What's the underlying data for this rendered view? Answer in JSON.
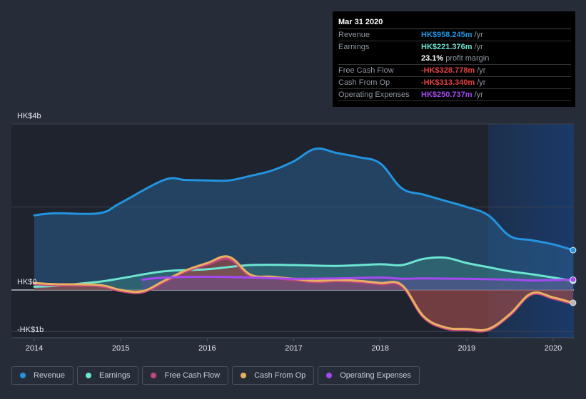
{
  "tooltip": {
    "date": "Mar 31 2020",
    "rows": [
      {
        "label": "Revenue",
        "value": "HK$958.245m",
        "unit": "/yr",
        "color": "#2394df"
      },
      {
        "label": "Earnings",
        "value": "HK$221.376m",
        "unit": "/yr",
        "color": "#6ce5d1"
      },
      {
        "label": "",
        "value": "23.1%",
        "unit": "profit margin",
        "color": "#ffffff"
      },
      {
        "label": "Free Cash Flow",
        "value": "-HK$328.778m",
        "unit": "/yr",
        "color": "#e64141"
      },
      {
        "label": "Cash From Op",
        "value": "-HK$313.340m",
        "unit": "/yr",
        "color": "#e64141"
      },
      {
        "label": "Operating Expenses",
        "value": "HK$250.737m",
        "unit": "/yr",
        "color": "#a44af1"
      }
    ]
  },
  "legend": [
    {
      "label": "Revenue",
      "color": "#2394df"
    },
    {
      "label": "Earnings",
      "color": "#6ce5d1"
    },
    {
      "label": "Free Cash Flow",
      "color": "#c4477f"
    },
    {
      "label": "Cash From Op",
      "color": "#e9b062"
    },
    {
      "label": "Operating Expenses",
      "color": "#a44af1"
    }
  ],
  "chart_data": {
    "type": "area",
    "title": "",
    "xlabel": "",
    "ylabel": "",
    "x_ticks": [
      "2014",
      "2015",
      "2016",
      "2017",
      "2018",
      "2019",
      "2020"
    ],
    "y_ticks": [
      {
        "value": 4,
        "label": "HK$4b"
      },
      {
        "value": 0,
        "label": "HK$0"
      },
      {
        "value": -1,
        "label": "-HK$1b"
      }
    ],
    "ylim": [
      -1,
      4
    ],
    "xlim": [
      2013.75,
      2020.25
    ],
    "units": "HK$ billions",
    "forecast_shade_from": 2019.25,
    "legend_position": "bottom",
    "series": [
      {
        "name": "Revenue",
        "color": "#2394df",
        "x": [
          2014.0,
          2014.25,
          2014.75,
          2015.0,
          2015.5,
          2015.75,
          2016.0,
          2016.25,
          2016.5,
          2016.75,
          2017.0,
          2017.25,
          2017.5,
          2017.75,
          2018.0,
          2018.25,
          2018.5,
          2018.75,
          2019.0,
          2019.25,
          2019.5,
          2019.75,
          2020.0,
          2020.23
        ],
        "values": [
          1.8,
          1.85,
          1.85,
          2.1,
          2.65,
          2.65,
          2.64,
          2.64,
          2.75,
          2.88,
          3.1,
          3.4,
          3.3,
          3.2,
          3.05,
          2.45,
          2.3,
          2.15,
          2.0,
          1.8,
          1.3,
          1.2,
          1.1,
          0.96
        ]
      },
      {
        "name": "Earnings",
        "color": "#6ce5d1",
        "x": [
          2014.0,
          2014.25,
          2014.75,
          2015.0,
          2015.5,
          2016.0,
          2016.5,
          2017.0,
          2017.5,
          2018.0,
          2018.25,
          2018.5,
          2018.75,
          2019.0,
          2019.25,
          2019.5,
          2019.75,
          2020.0,
          2020.23
        ],
        "values": [
          0.08,
          0.1,
          0.2,
          0.28,
          0.45,
          0.5,
          0.6,
          0.6,
          0.58,
          0.62,
          0.6,
          0.75,
          0.78,
          0.65,
          0.55,
          0.45,
          0.38,
          0.3,
          0.22
        ]
      },
      {
        "name": "Free Cash Flow",
        "color": "#c4477f",
        "x": [
          2014.0,
          2014.25,
          2014.75,
          2015.0,
          2015.25,
          2015.5,
          2015.75,
          2016.0,
          2016.25,
          2016.5,
          2016.75,
          2017.0,
          2017.25,
          2017.5,
          2017.75,
          2018.0,
          2018.25,
          2018.5,
          2018.75,
          2019.0,
          2019.25,
          2019.5,
          2019.75,
          2020.0,
          2020.23
        ],
        "values": [
          0.15,
          0.12,
          0.1,
          -0.02,
          -0.05,
          0.2,
          0.45,
          0.62,
          0.75,
          0.35,
          0.3,
          0.25,
          0.2,
          0.22,
          0.2,
          0.15,
          0.1,
          -0.65,
          -0.92,
          -0.96,
          -0.96,
          -0.6,
          -0.1,
          -0.2,
          -0.33
        ]
      },
      {
        "name": "Cash From Op",
        "color": "#e9b062",
        "x": [
          2014.0,
          2014.25,
          2014.75,
          2015.0,
          2015.25,
          2015.5,
          2015.75,
          2016.0,
          2016.25,
          2016.5,
          2016.75,
          2017.0,
          2017.25,
          2017.5,
          2017.75,
          2018.0,
          2018.25,
          2018.5,
          2018.75,
          2019.0,
          2019.25,
          2019.5,
          2019.75,
          2020.0,
          2020.23
        ],
        "values": [
          0.17,
          0.14,
          0.12,
          0.0,
          -0.03,
          0.22,
          0.47,
          0.65,
          0.8,
          0.37,
          0.32,
          0.27,
          0.22,
          0.24,
          0.22,
          0.17,
          0.12,
          -0.63,
          -0.9,
          -0.94,
          -0.94,
          -0.58,
          -0.08,
          -0.18,
          -0.31
        ]
      },
      {
        "name": "Operating Expenses",
        "color": "#a44af1",
        "x": [
          2015.25,
          2015.5,
          2016.0,
          2016.5,
          2017.0,
          2017.5,
          2018.0,
          2018.25,
          2018.5,
          2019.0,
          2019.5,
          2019.75,
          2020.0,
          2020.23
        ],
        "values": [
          0.25,
          0.3,
          0.32,
          0.3,
          0.27,
          0.28,
          0.3,
          0.27,
          0.28,
          0.27,
          0.25,
          0.23,
          0.24,
          0.25
        ]
      }
    ]
  }
}
